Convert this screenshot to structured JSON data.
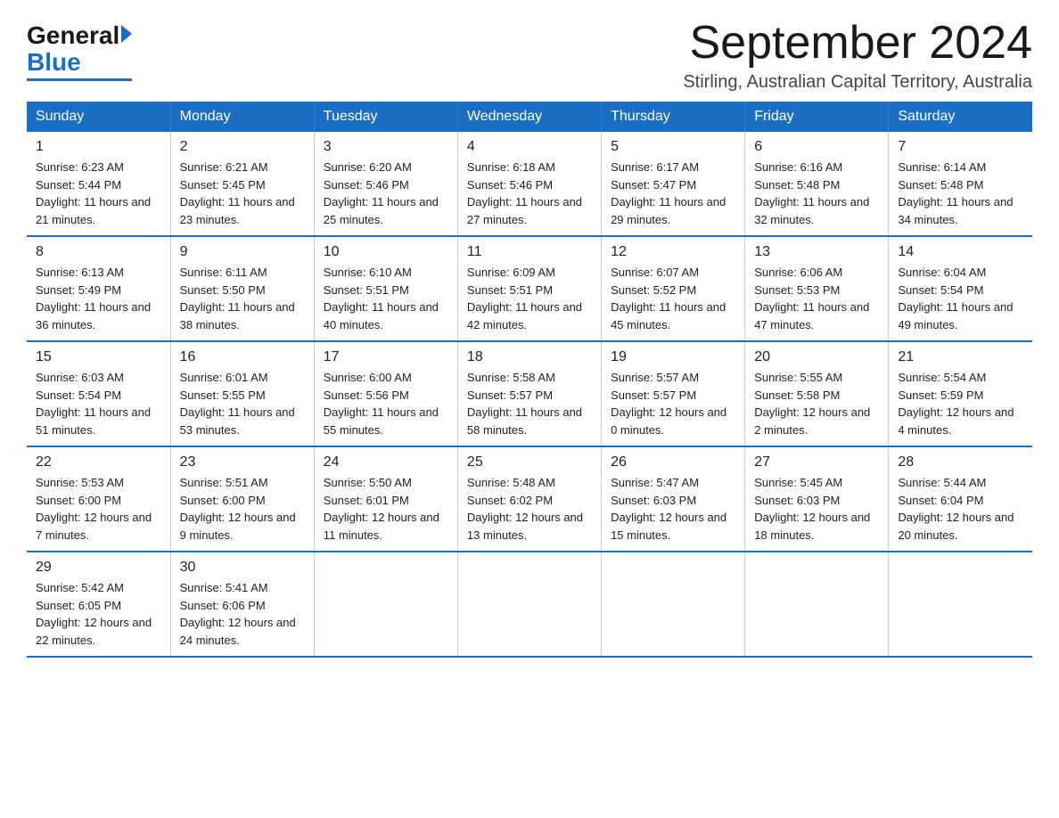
{
  "logo": {
    "general": "General",
    "blue": "Blue"
  },
  "title": {
    "month": "September 2024",
    "location": "Stirling, Australian Capital Territory, Australia"
  },
  "weekdays": [
    "Sunday",
    "Monday",
    "Tuesday",
    "Wednesday",
    "Thursday",
    "Friday",
    "Saturday"
  ],
  "weeks": [
    [
      {
        "day": "1",
        "sunrise": "6:23 AM",
        "sunset": "5:44 PM",
        "daylight": "11 hours and 21 minutes."
      },
      {
        "day": "2",
        "sunrise": "6:21 AM",
        "sunset": "5:45 PM",
        "daylight": "11 hours and 23 minutes."
      },
      {
        "day": "3",
        "sunrise": "6:20 AM",
        "sunset": "5:46 PM",
        "daylight": "11 hours and 25 minutes."
      },
      {
        "day": "4",
        "sunrise": "6:18 AM",
        "sunset": "5:46 PM",
        "daylight": "11 hours and 27 minutes."
      },
      {
        "day": "5",
        "sunrise": "6:17 AM",
        "sunset": "5:47 PM",
        "daylight": "11 hours and 29 minutes."
      },
      {
        "day": "6",
        "sunrise": "6:16 AM",
        "sunset": "5:48 PM",
        "daylight": "11 hours and 32 minutes."
      },
      {
        "day": "7",
        "sunrise": "6:14 AM",
        "sunset": "5:48 PM",
        "daylight": "11 hours and 34 minutes."
      }
    ],
    [
      {
        "day": "8",
        "sunrise": "6:13 AM",
        "sunset": "5:49 PM",
        "daylight": "11 hours and 36 minutes."
      },
      {
        "day": "9",
        "sunrise": "6:11 AM",
        "sunset": "5:50 PM",
        "daylight": "11 hours and 38 minutes."
      },
      {
        "day": "10",
        "sunrise": "6:10 AM",
        "sunset": "5:51 PM",
        "daylight": "11 hours and 40 minutes."
      },
      {
        "day": "11",
        "sunrise": "6:09 AM",
        "sunset": "5:51 PM",
        "daylight": "11 hours and 42 minutes."
      },
      {
        "day": "12",
        "sunrise": "6:07 AM",
        "sunset": "5:52 PM",
        "daylight": "11 hours and 45 minutes."
      },
      {
        "day": "13",
        "sunrise": "6:06 AM",
        "sunset": "5:53 PM",
        "daylight": "11 hours and 47 minutes."
      },
      {
        "day": "14",
        "sunrise": "6:04 AM",
        "sunset": "5:54 PM",
        "daylight": "11 hours and 49 minutes."
      }
    ],
    [
      {
        "day": "15",
        "sunrise": "6:03 AM",
        "sunset": "5:54 PM",
        "daylight": "11 hours and 51 minutes."
      },
      {
        "day": "16",
        "sunrise": "6:01 AM",
        "sunset": "5:55 PM",
        "daylight": "11 hours and 53 minutes."
      },
      {
        "day": "17",
        "sunrise": "6:00 AM",
        "sunset": "5:56 PM",
        "daylight": "11 hours and 55 minutes."
      },
      {
        "day": "18",
        "sunrise": "5:58 AM",
        "sunset": "5:57 PM",
        "daylight": "11 hours and 58 minutes."
      },
      {
        "day": "19",
        "sunrise": "5:57 AM",
        "sunset": "5:57 PM",
        "daylight": "12 hours and 0 minutes."
      },
      {
        "day": "20",
        "sunrise": "5:55 AM",
        "sunset": "5:58 PM",
        "daylight": "12 hours and 2 minutes."
      },
      {
        "day": "21",
        "sunrise": "5:54 AM",
        "sunset": "5:59 PM",
        "daylight": "12 hours and 4 minutes."
      }
    ],
    [
      {
        "day": "22",
        "sunrise": "5:53 AM",
        "sunset": "6:00 PM",
        "daylight": "12 hours and 7 minutes."
      },
      {
        "day": "23",
        "sunrise": "5:51 AM",
        "sunset": "6:00 PM",
        "daylight": "12 hours and 9 minutes."
      },
      {
        "day": "24",
        "sunrise": "5:50 AM",
        "sunset": "6:01 PM",
        "daylight": "12 hours and 11 minutes."
      },
      {
        "day": "25",
        "sunrise": "5:48 AM",
        "sunset": "6:02 PM",
        "daylight": "12 hours and 13 minutes."
      },
      {
        "day": "26",
        "sunrise": "5:47 AM",
        "sunset": "6:03 PM",
        "daylight": "12 hours and 15 minutes."
      },
      {
        "day": "27",
        "sunrise": "5:45 AM",
        "sunset": "6:03 PM",
        "daylight": "12 hours and 18 minutes."
      },
      {
        "day": "28",
        "sunrise": "5:44 AM",
        "sunset": "6:04 PM",
        "daylight": "12 hours and 20 minutes."
      }
    ],
    [
      {
        "day": "29",
        "sunrise": "5:42 AM",
        "sunset": "6:05 PM",
        "daylight": "12 hours and 22 minutes."
      },
      {
        "day": "30",
        "sunrise": "5:41 AM",
        "sunset": "6:06 PM",
        "daylight": "12 hours and 24 minutes."
      },
      null,
      null,
      null,
      null,
      null
    ]
  ]
}
